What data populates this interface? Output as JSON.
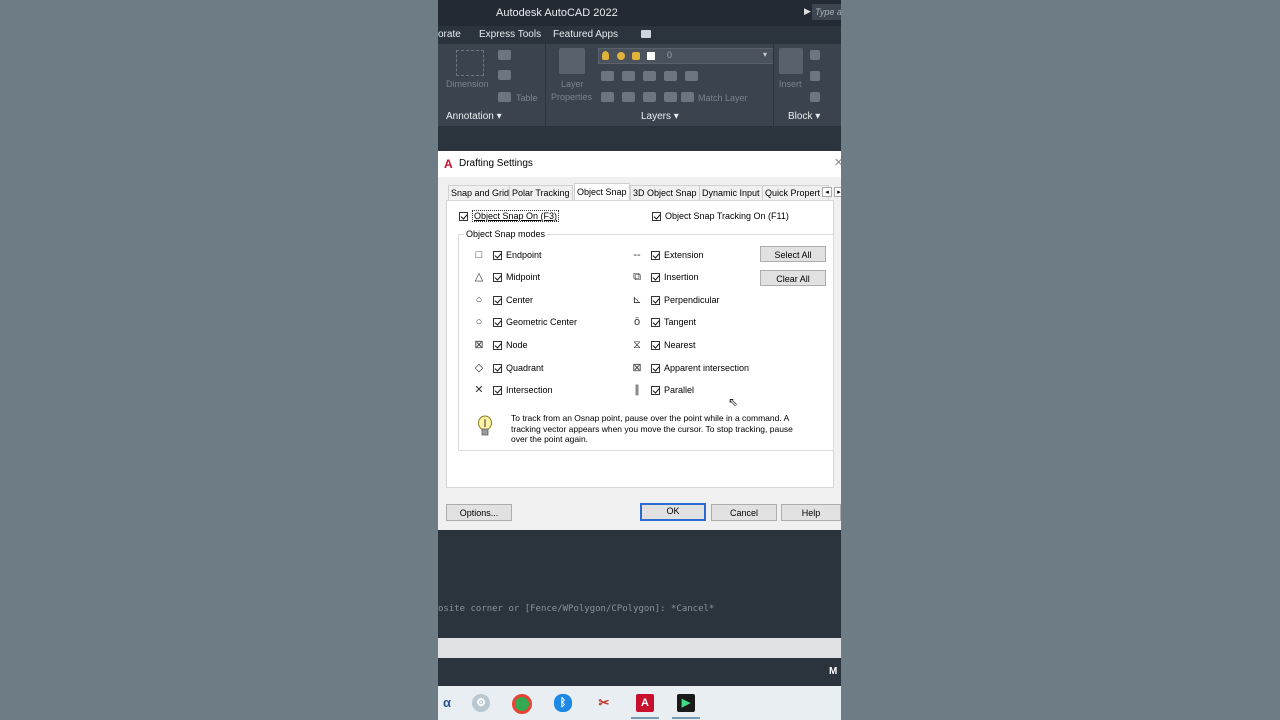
{
  "window": {
    "title": "Autodesk AutoCAD 2022",
    "search_placeholder": "Type a"
  },
  "ribbon_tabs": [
    "orate",
    "Express Tools",
    "Featured Apps"
  ],
  "ribbon": {
    "annotation": {
      "label": "Annotation ▾",
      "dimension": "Dimension",
      "table": "Table"
    },
    "layers": {
      "label": "Layers ▾",
      "layer_properties_1": "Layer",
      "layer_properties_2": "Properties",
      "match_layer": "Match Layer",
      "current_layer": "0"
    },
    "block": {
      "label": "Block ▾",
      "insert": "Insert"
    }
  },
  "dialog": {
    "title": "Drafting Settings",
    "tabs": [
      "Snap and Grid",
      "Polar Tracking",
      "Object Snap",
      "3D Object Snap",
      "Dynamic Input",
      "Quick Propert"
    ],
    "active_tab": "Object Snap",
    "osnap_on": {
      "label": "Object Snap On (F3)",
      "checked": true
    },
    "otrack_on": {
      "label": "Object Snap Tracking On (F11)",
      "checked": true
    },
    "modes_label": "Object Snap modes",
    "left_modes": [
      {
        "symbol": "□",
        "label": "Endpoint",
        "checked": true
      },
      {
        "symbol": "△",
        "label": "Midpoint",
        "checked": true
      },
      {
        "symbol": "○",
        "label": "Center",
        "checked": true
      },
      {
        "symbol": "○",
        "label": "Geometric Center",
        "checked": true
      },
      {
        "symbol": "⊠",
        "label": "Node",
        "checked": true
      },
      {
        "symbol": "◇",
        "label": "Quadrant",
        "checked": true
      },
      {
        "symbol": "✕",
        "label": "Intersection",
        "checked": true
      }
    ],
    "right_modes": [
      {
        "symbol": "--",
        "label": "Extension",
        "checked": true
      },
      {
        "symbol": "⧉",
        "label": "Insertion",
        "checked": true
      },
      {
        "symbol": "⊾",
        "label": "Perpendicular",
        "checked": true
      },
      {
        "symbol": "ō",
        "label": "Tangent",
        "checked": true
      },
      {
        "symbol": "⧖",
        "label": "Nearest",
        "checked": true
      },
      {
        "symbol": "⊠",
        "label": "Apparent intersection",
        "checked": true
      },
      {
        "symbol": "∥",
        "label": "Parallel",
        "checked": true
      }
    ],
    "select_all": "Select All",
    "clear_all": "Clear All",
    "tip": "To track from an Osnap point, pause over the point while in a command.  A tracking vector appears when you move the cursor.  To stop tracking, pause over the point again.",
    "buttons": {
      "options": "Options...",
      "ok": "OK",
      "cancel": "Cancel",
      "help": "Help"
    }
  },
  "command_history": "osite corner or [Fence/WPolygon/CPolygon]: *Cancel*",
  "status": {
    "model_letter": "M"
  }
}
